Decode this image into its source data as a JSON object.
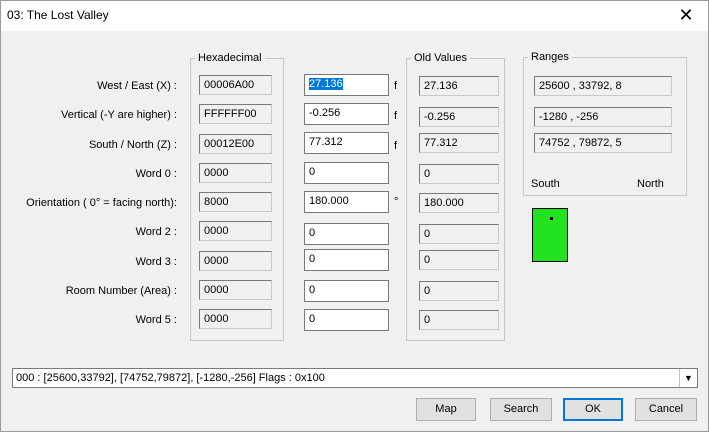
{
  "window": {
    "title": "03: The Lost Valley",
    "close_glyph": "✕"
  },
  "groups": {
    "hex": "Hexadecimal",
    "old": "Old Values",
    "ranges": "Ranges"
  },
  "rows": [
    {
      "label": "West / East (X) :",
      "hex": "00006A00",
      "value": "27.136",
      "unit": "f",
      "old": "27.136"
    },
    {
      "label": "Vertical (-Y are higher) :",
      "hex": "FFFFFF00",
      "value": "-0.256",
      "unit": "f",
      "old": "-0.256"
    },
    {
      "label": "South / North (Z) :",
      "hex": "00012E00",
      "value": "77.312",
      "unit": "f",
      "old": "77.312"
    },
    {
      "label": "Word 0 :",
      "hex": "0000",
      "value": "0",
      "unit": "",
      "old": "0"
    },
    {
      "label": "Orientation ( 0° = facing north):",
      "hex": "8000",
      "value": "180.000",
      "unit": "°",
      "old": "180.000"
    },
    {
      "label": "Word 2 :",
      "hex": "0000",
      "value": "0",
      "unit": "",
      "old": "0"
    },
    {
      "label": "Word 3 :",
      "hex": "0000",
      "value": "0",
      "unit": "",
      "old": "0"
    },
    {
      "label": "Room Number (Area) :",
      "hex": "0000",
      "value": "0",
      "unit": "",
      "old": "0"
    },
    {
      "label": "Word 5 :",
      "hex": "0000",
      "value": "0",
      "unit": "",
      "old": "0"
    }
  ],
  "ranges": {
    "x": "25600 , 33792, 8",
    "y": "-1280 , -256",
    "z": "74752 , 79872, 5",
    "left_label": "South",
    "right_label": "North"
  },
  "combo": {
    "value": "000 : [25600,33792], [74752,79872], [-1280,-256] Flags : 0x100",
    "arrow": "▼"
  },
  "buttons": {
    "map": "Map",
    "search": "Search",
    "ok": "OK",
    "cancel": "Cancel"
  },
  "colors": {
    "minimap": "#22e222",
    "selection": "#0078d7"
  }
}
